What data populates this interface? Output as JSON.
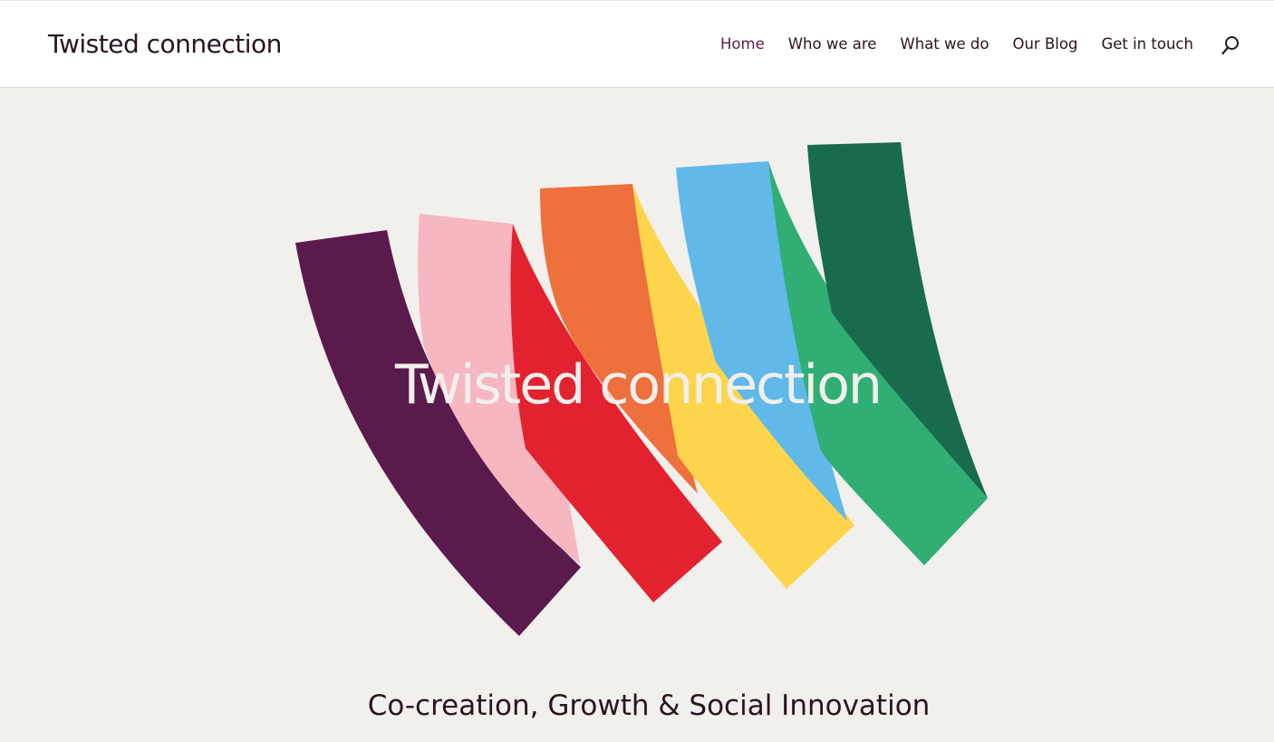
{
  "site": {
    "logo_text": "Twisted connection"
  },
  "nav": {
    "items": [
      {
        "label": "Home",
        "active": true
      },
      {
        "label": "Who we are",
        "active": false
      },
      {
        "label": "What we do",
        "active": false
      },
      {
        "label": "Our Blog",
        "active": false
      },
      {
        "label": "Get in touch",
        "active": false
      }
    ],
    "search_icon": "search-icon"
  },
  "hero": {
    "title": "Twisted connection",
    "tagline": "Co-creation, Growth & Social Innovation",
    "ribbon_colors": [
      "#5a1a4c",
      "#f6b7c0",
      "#e32230",
      "#ee703c",
      "#fcd54c",
      "#60b9e9",
      "#31ae74",
      "#186b4b"
    ]
  },
  "colors": {
    "text": "#2a1421",
    "accent": "#5a1a4c",
    "background": "#f2f0ed",
    "header_bg": "#ffffff"
  }
}
